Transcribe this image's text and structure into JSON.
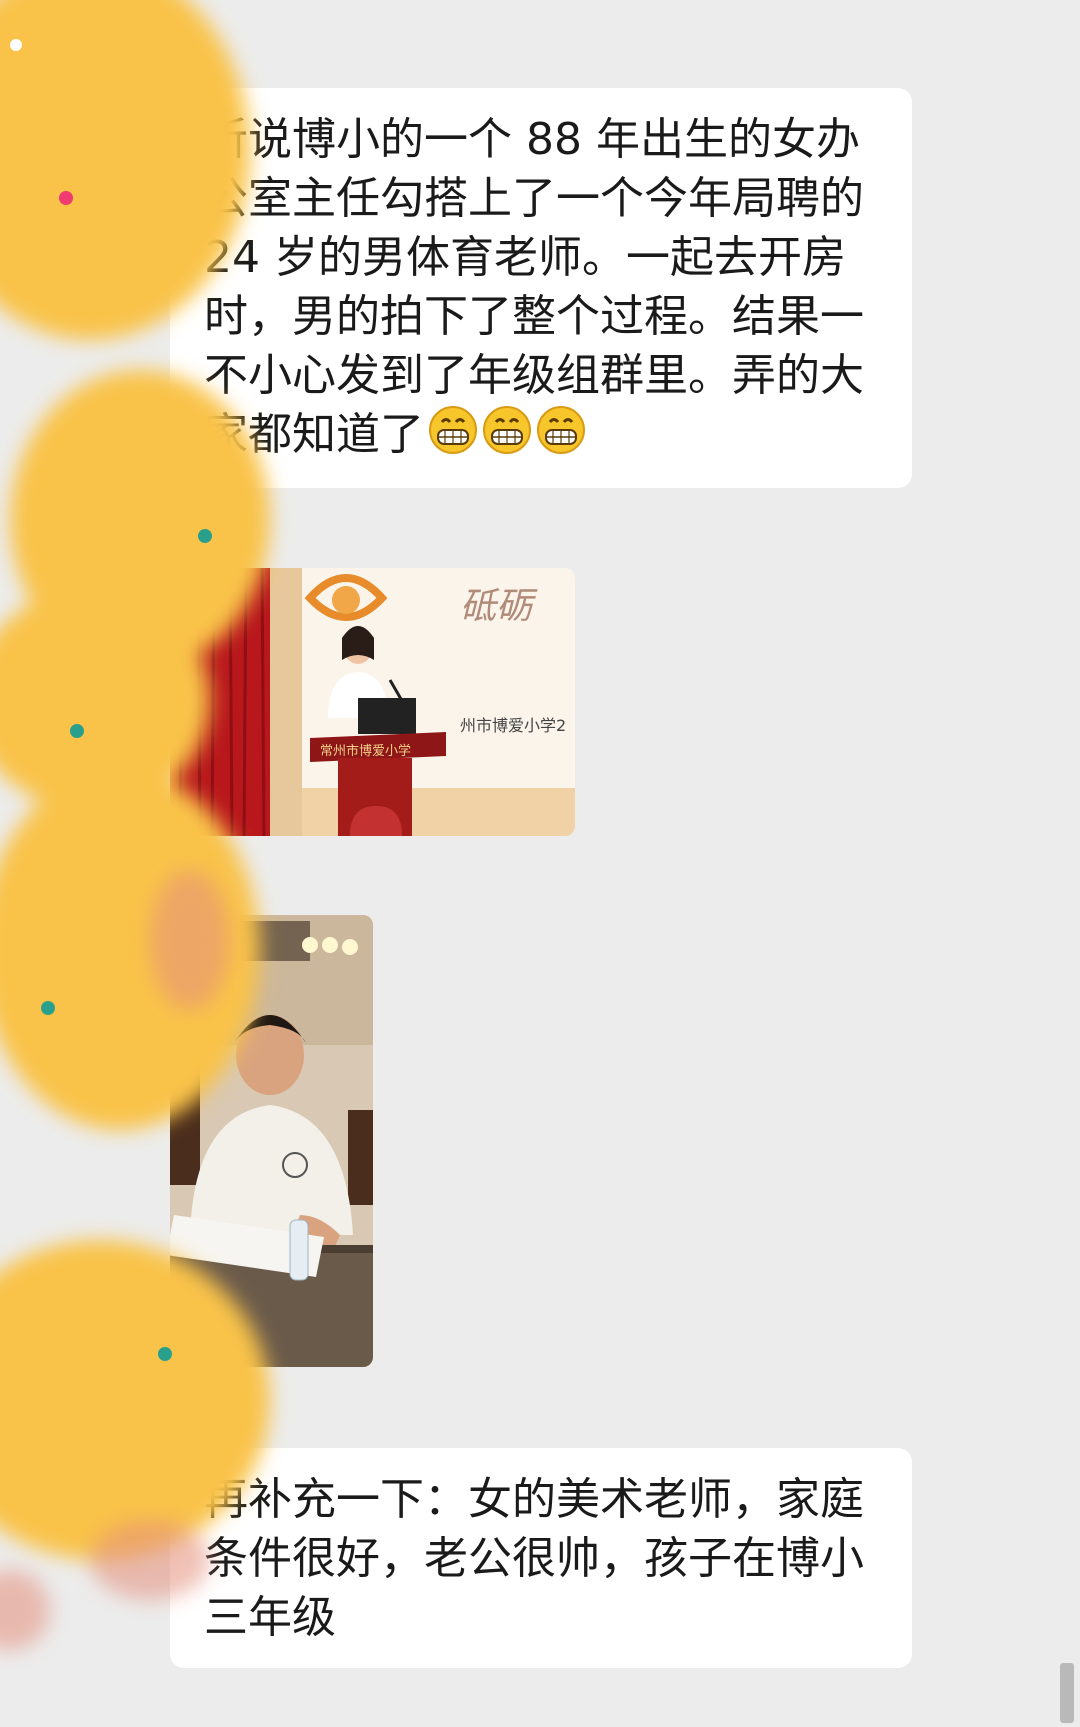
{
  "messages": [
    {
      "type": "text",
      "text": "听说博小的一个 88 年出生的女办公室主任勾搭上了一个今年局聘的 24 岁的男体育老师。一起去开房时，男的拍下了整个过程。结果一不小心发到了年级组群里。弄的大家都知道了",
      "trailing_emoji": [
        "grin-face-icon",
        "grin-face-icon",
        "grin-face-icon"
      ]
    },
    {
      "type": "image",
      "icon": "photo-woman-at-podium",
      "visible_text": [
        "砥砺",
        "常州市博爱小学",
        "州市博爱小学2"
      ]
    },
    {
      "type": "image",
      "icon": "photo-man-writing-at-table"
    },
    {
      "type": "text",
      "text": "再补充一下：女的美术老师，家庭条件很好，老公很帅，孩子在博小三年级"
    }
  ],
  "colors": {
    "background": "#ececec",
    "bubble": "#ffffff",
    "text": "#1a1a1a",
    "overlay_blob": "#f9c34a"
  }
}
